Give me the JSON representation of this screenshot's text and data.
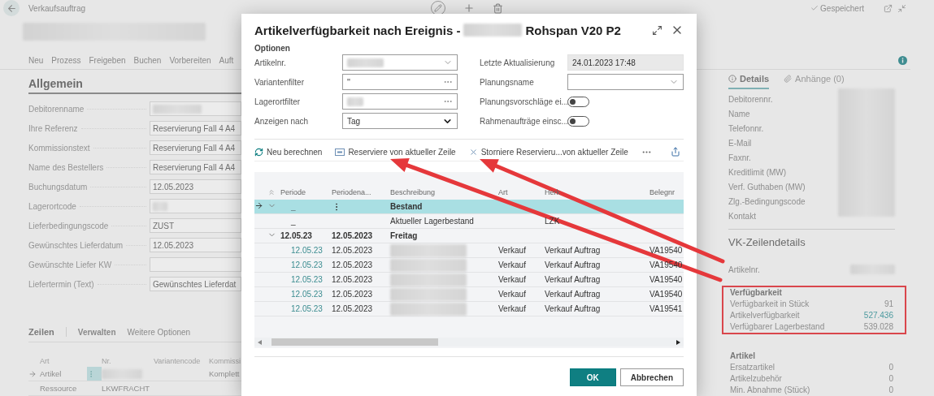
{
  "page": {
    "title": "Verkaufsauftrag",
    "status": "Gespeichert",
    "actions": [
      "Neu",
      "Prozess",
      "Freigeben",
      "Buchen",
      "Vorbereiten",
      "Auft"
    ]
  },
  "general": {
    "heading": "Allgemein",
    "fields": [
      {
        "label": "Debitorenname",
        "kind": "blurred"
      },
      {
        "label": "Ihre Referenz",
        "kind": "text",
        "value": "Reservierung Fall 4 A4"
      },
      {
        "label": "Kommissionstext",
        "kind": "text",
        "value": "Reservierung Fall 4 A4"
      },
      {
        "label": "Name des Bestellers",
        "kind": "text",
        "value": "Reservierung Fall 4 A4"
      },
      {
        "label": "Buchungsdatum",
        "kind": "text",
        "value": "12.05.2023"
      },
      {
        "label": "Lagerortcode",
        "kind": "blurred"
      },
      {
        "label": "Lieferbedingungscode",
        "kind": "text",
        "value": "ZUST"
      },
      {
        "label": "Gewünschtes Lieferdatum",
        "kind": "text",
        "value": "12.05.2023"
      },
      {
        "label": "Gewünschte Liefer KW",
        "kind": "text"
      },
      {
        "label": "Liefertermin (Text)",
        "kind": "text",
        "value": "Gewünschtes Lieferdat"
      }
    ]
  },
  "lines": {
    "title": "Zeilen",
    "actions": [
      "Verwalten",
      "Weitere Optionen"
    ],
    "columns": [
      "Art",
      "Nr.",
      "Variantencode",
      "Kommissi"
    ],
    "rows": [
      {
        "selected": true,
        "cells": [
          {
            "kind": "text",
            "text": "Artikel"
          },
          {
            "kind": "blurred"
          },
          {
            "kind": "empty"
          },
          {
            "kind": "text",
            "text": "Komplett"
          }
        ]
      },
      {
        "selected": false,
        "cells": [
          {
            "kind": "text",
            "text": "Ressource"
          },
          {
            "kind": "text",
            "text": "LKWFRACHT"
          },
          {
            "kind": "empty"
          },
          {
            "kind": "empty"
          }
        ]
      }
    ]
  },
  "factbox": {
    "tabs": [
      {
        "label": "Details",
        "selected": true
      },
      {
        "label": "Anhänge (0)",
        "selected": false
      }
    ],
    "details": [
      "Debitorennr.",
      "Name",
      "Telefonnr.",
      "E-Mail",
      "Faxnr.",
      "Kreditlimit (MW)",
      "Verf. Guthaben (MW)",
      "Zlg.-Bedingungscode",
      "Kontakt"
    ],
    "line_heading": "VK-Zeilendetails",
    "item_label": "Artikelnr.",
    "groups": [
      {
        "title": "Verfügbarkeit",
        "highlighted": true,
        "rows": [
          {
            "label": "Verfügbarkeit in Stück",
            "value": "91",
            "link": false
          },
          {
            "label": "Artikelverfügbarkeit",
            "value": "527.436",
            "link": true
          },
          {
            "label": "Verfügbarer Lagerbestand",
            "value": "539.028",
            "link": false
          }
        ]
      },
      {
        "title": "Artikel",
        "highlighted": false,
        "rows": [
          {
            "label": "Ersatzartikel",
            "value": "0",
            "link": false
          },
          {
            "label": "Artikelzubehör",
            "value": "0",
            "link": false
          },
          {
            "label": "Min. Abnahme (Stück)",
            "value": "0",
            "link": false
          }
        ]
      }
    ]
  },
  "dialog": {
    "title": "Artikelverfügbarkeit nach Ereignis -",
    "title_end": "Rohspan V20 P2",
    "section": "Optionen",
    "left_fields": [
      {
        "label": "Artikelnr.",
        "kind": "dropdown",
        "blurred": true
      },
      {
        "label": "Variantenfilter",
        "kind": "lookup",
        "blurred": false,
        "value": "''"
      },
      {
        "label": "Lagerortfilter",
        "kind": "lookup",
        "blurred": true
      },
      {
        "label": "Anzeigen nach",
        "kind": "select",
        "blurred": false,
        "value": "Tag"
      }
    ],
    "right_fields": [
      {
        "label": "Letzte Aktualisierung",
        "kind": "readonly",
        "blurred": false,
        "value": "24.01.2023 17:48"
      },
      {
        "label": "Planungsname",
        "kind": "dropdown",
        "blurred": false
      },
      {
        "label": "Planungsvorschläge ei...",
        "kind": "toggle",
        "on": false
      },
      {
        "label": "Rahmenaufträge einsc...",
        "kind": "toggle",
        "on": false
      }
    ],
    "actions": [
      {
        "label": "Neu berechnen",
        "kind": "refresh"
      },
      {
        "label": "Reserviere von aktueller Zeile",
        "kind": "reserve"
      },
      {
        "label": "Storniere Reservieru...von aktueller Zeile",
        "kind": "cancel"
      }
    ],
    "grid": {
      "columns": [
        "Periode",
        "Periodena...",
        "Beschreibung",
        "Art",
        "Herk",
        "Belegnr"
      ],
      "rows": [
        {
          "kind": "group",
          "selected": true,
          "expanded": true,
          "period": "_",
          "description": "Bestand"
        },
        {
          "kind": "stock",
          "selected": false,
          "period": "_",
          "description": "Aktueller Lagerbestand",
          "source": "LZK"
        },
        {
          "kind": "group",
          "selected": false,
          "expanded": true,
          "period": "12.05.23",
          "period_end": "12.05.2023",
          "description": "Freitag"
        },
        {
          "kind": "entry",
          "selected": false,
          "period": "12.05.23",
          "period_end": "12.05.2023",
          "type": "Verkauf",
          "source": "Verkauf Auftrag",
          "document": "VA19540"
        },
        {
          "kind": "entry",
          "selected": false,
          "period": "12.05.23",
          "period_end": "12.05.2023",
          "type": "Verkauf",
          "source": "Verkauf Auftrag",
          "document": "VA19540"
        },
        {
          "kind": "entry",
          "selected": false,
          "period": "12.05.23",
          "period_end": "12.05.2023",
          "type": "Verkauf",
          "source": "Verkauf Auftrag",
          "document": "VA19540"
        },
        {
          "kind": "entry",
          "selected": false,
          "period": "12.05.23",
          "period_end": "12.05.2023",
          "type": "Verkauf",
          "source": "Verkauf Auftrag",
          "document": "VA19540"
        },
        {
          "kind": "entry",
          "selected": false,
          "period": "12.05.23",
          "period_end": "12.05.2023",
          "type": "Verkauf",
          "source": "Verkauf Auftrag",
          "document": "VA19541"
        }
      ]
    },
    "buttons": [
      {
        "label": "OK",
        "kind": "primary"
      },
      {
        "label": "Abbrechen",
        "kind": "secondary"
      }
    ]
  }
}
